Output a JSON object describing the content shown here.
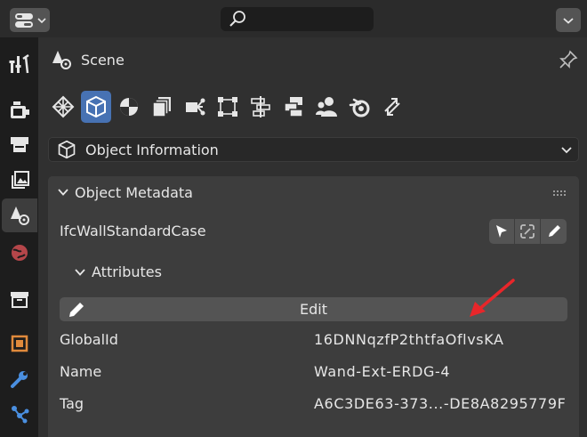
{
  "search": {
    "placeholder": ""
  },
  "header": {
    "title": "Scene"
  },
  "section_select": {
    "value": "Object Information"
  },
  "panel": {
    "title": "Object Metadata",
    "ifc_class": "IfcWallStandardCase",
    "attributes_label": "Attributes",
    "edit_label": "Edit",
    "attributes": [
      {
        "key": "GlobalId",
        "value": "16DNNqzfP2thtfaOflvsKA"
      },
      {
        "key": "Name",
        "value": "Wand-Ext-ERDG-4"
      },
      {
        "key": "Tag",
        "value": "A6C3DE63-373...-DE8A8295779F"
      }
    ]
  },
  "colors": {
    "accent": "#4772b3",
    "annotation": "#e8262a"
  }
}
